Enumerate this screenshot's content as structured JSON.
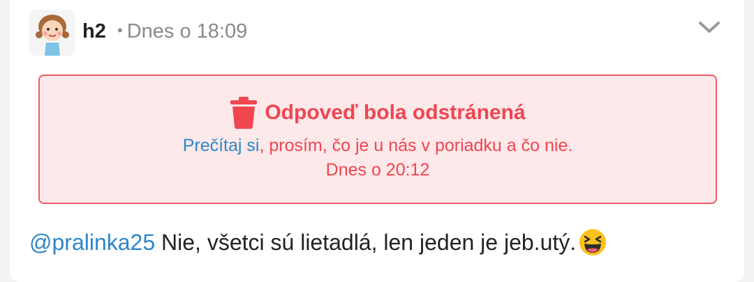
{
  "post": {
    "username": "h2",
    "separator": "•",
    "timestamp": "Dnes o 18:09"
  },
  "deleted_notice": {
    "icon": "trash-icon",
    "title": "Odpoveď bola odstránená",
    "link_text": "Prečítaj si",
    "text_after_link": ", prosím, čo je u nás v poriadku a čo nie.",
    "time": "Dnes o 20:12"
  },
  "message": {
    "mention": "@pralinka25",
    "text": " Nie, všetci sú lietadlá, len jeden je jeb.utý.",
    "emoji": "laughing-squint-emoji"
  },
  "colors": {
    "notice_background": "#fde8ea",
    "notice_border": "#ef5d66",
    "notice_text": "#ef4650",
    "link": "#2d86c9",
    "meta": "#8a8a8a"
  }
}
